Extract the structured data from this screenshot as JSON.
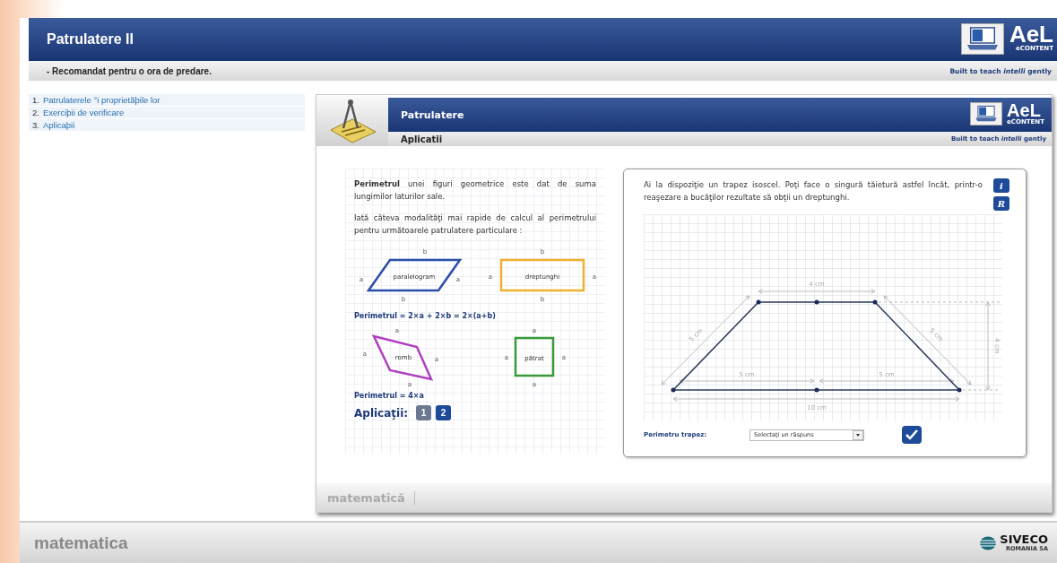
{
  "header": {
    "title": "Patrulatere II",
    "subtitle": "- Recomandat pentru o ora de predare."
  },
  "logos": [
    {
      "name": "AeL",
      "sub": "eCONTENT",
      "tagline": "Built to teach *intelli* gently"
    },
    {
      "name": "AeL",
      "sub": "eCONTENT",
      "tagline": "Built to teach *intelli* gently"
    }
  ],
  "sidebar": {
    "items": [
      {
        "number": "1.",
        "label": "Patrulaterele °i proprietãþile lor"
      },
      {
        "number": "2.",
        "label": "Exerciþii de verificare"
      },
      {
        "number": "3.",
        "label": "Aplicaþii"
      }
    ]
  },
  "panel": {
    "title": "Patrulatere",
    "section": "Aplicatii",
    "left_card": {
      "intro": "**Perimetrul** unei figuri geometrice este dat de suma lungimilor laturilor sale.",
      "lead": "Iată câteva modalităţi mai rapide de calcul al perimetrului pentru următoarele patrulatere particulare :",
      "shape_rows": [
        {
          "shapes": [
            {
              "kind": "parallelogram",
              "name": "paralelogram",
              "color": "#2a4fa8",
              "top": "b",
              "left": "a",
              "right": "a",
              "bottom": "b"
            },
            {
              "kind": "rectangle",
              "name": "dreptunghi",
              "color": "#f0b030",
              "top": "b",
              "left": "a",
              "right": "a",
              "bottom": "b"
            }
          ],
          "formula": "Perimetrul = 2×a + 2×b = 2×(a+b)"
        },
        {
          "shapes": [
            {
              "kind": "rhombus",
              "name": "romb",
              "color": "#b040c0",
              "top": "a",
              "left": "a",
              "right": "a",
              "bottom": "a"
            },
            {
              "kind": "square",
              "name": "pătrat",
              "color": "#3a9a3a",
              "top": "a",
              "left": "a",
              "right": "a",
              "bottom": "a"
            }
          ],
          "formula": "Perimetrul = 4×a"
        }
      ],
      "applications": {
        "label": "Aplicaţii:",
        "buttons": [
          {
            "label": "1",
            "selected": false
          },
          {
            "label": "2",
            "selected": true
          }
        ]
      }
    },
    "right_card": {
      "text": "Ai la dispoziţie un trapez isoscel. Poţi face o singură tăietură astfel încât, printr-o reaşezare a bucăţilor rezultate să obţii un dreptunghi.",
      "info_button": "i",
      "reset_button": "R",
      "dimensions": {
        "top": "4 cm",
        "left_side": "5 cm",
        "right_side": "5 cm",
        "height": "4 cm",
        "bottom_left": "5 cm",
        "bottom_right": "5 cm",
        "bottom": "10 cm"
      },
      "answer": {
        "label": "Perimetru trapez:",
        "placeholder": "Selectaţi un răspuns"
      }
    },
    "footer": "matematică"
  },
  "bottom_bar": {
    "title": "matematica",
    "brand": "SIVECO",
    "brand_sub": "ROMANIA SA"
  }
}
